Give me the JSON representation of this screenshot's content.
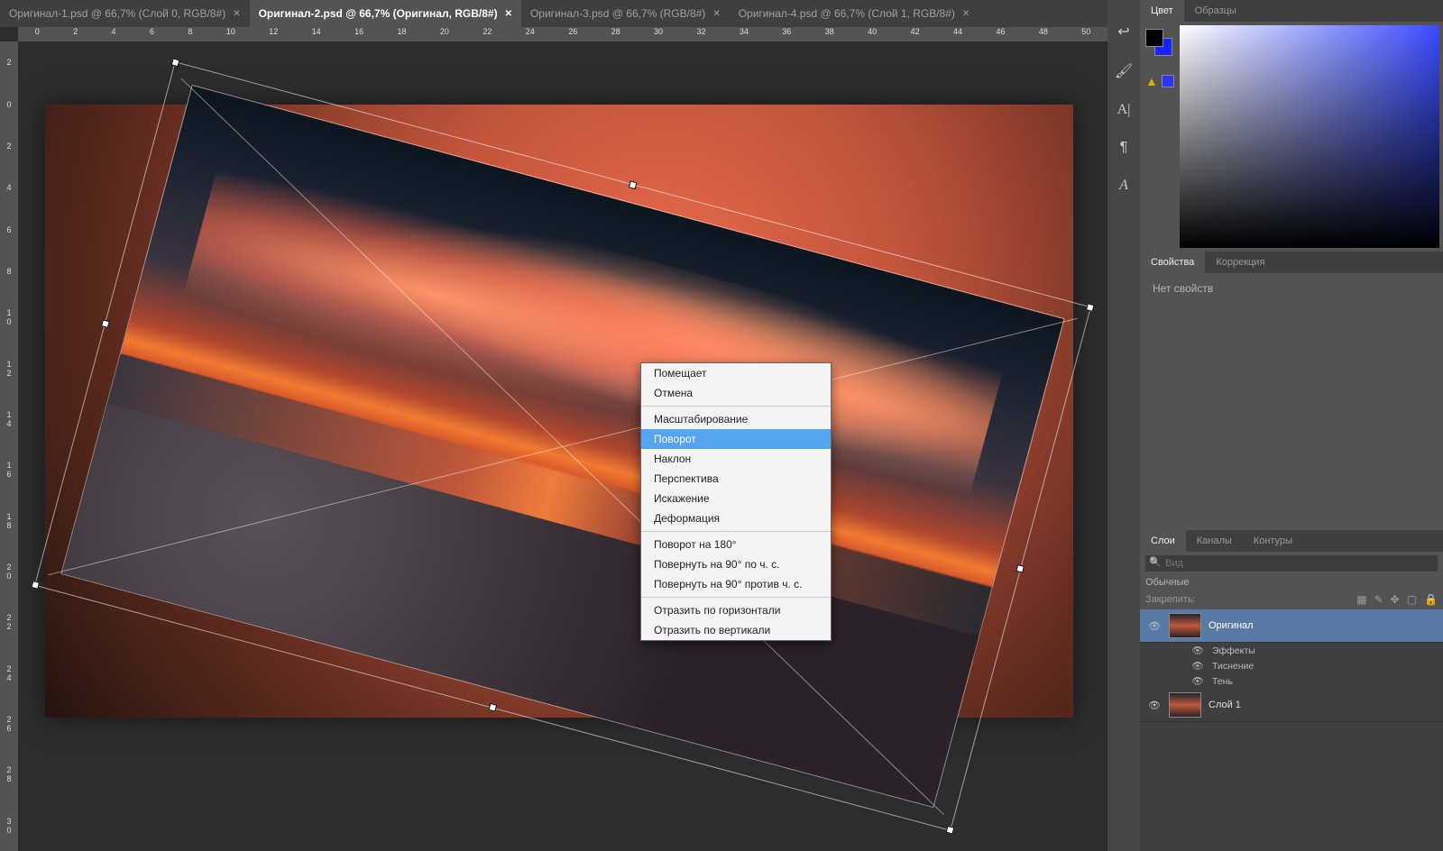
{
  "tabs": [
    {
      "label": "Оригинал-1.psd @ 66,7% (Слой 0, RGB/8#)"
    },
    {
      "label": "Оригинал-2.psd @ 66,7% (Оригинал, RGB/8#)"
    },
    {
      "label": "Оригинал-3.psd @ 66,7% (RGB/8#)"
    },
    {
      "label": "Оригинал-4.psd @ 66,7% (Слой 1, RGB/8#)"
    }
  ],
  "active_tab_index": 1,
  "ruler_h": [
    "0",
    "2",
    "4",
    "6",
    "8",
    "10",
    "12",
    "14",
    "16",
    "18",
    "20",
    "22",
    "24",
    "26",
    "28",
    "30",
    "32",
    "34",
    "36",
    "38",
    "40",
    "42",
    "44",
    "46",
    "48",
    "50"
  ],
  "ruler_v": [
    "2",
    "0",
    "2",
    "4",
    "6",
    "8",
    "1\n0",
    "1\n2",
    "1\n4",
    "1\n6",
    "1\n8",
    "2\n0",
    "2\n2",
    "2\n4",
    "2\n6",
    "2\n8",
    "3\n0"
  ],
  "contextmenu": [
    {
      "type": "item",
      "label": "Помещает"
    },
    {
      "type": "item",
      "label": "Отмена"
    },
    {
      "type": "sep"
    },
    {
      "type": "item",
      "label": "Масштабирование"
    },
    {
      "type": "item",
      "label": "Поворот",
      "highlight": true
    },
    {
      "type": "item",
      "label": "Наклон"
    },
    {
      "type": "item",
      "label": "Перспектива"
    },
    {
      "type": "item",
      "label": "Искажение"
    },
    {
      "type": "item",
      "label": "Деформация"
    },
    {
      "type": "sep"
    },
    {
      "type": "item",
      "label": "Поворот на 180°"
    },
    {
      "type": "item",
      "label": "Повернуть на 90° по ч. с."
    },
    {
      "type": "item",
      "label": "Повернуть на 90° против ч. с."
    },
    {
      "type": "sep"
    },
    {
      "type": "item",
      "label": "Отразить по горизонтали"
    },
    {
      "type": "item",
      "label": "Отразить по вертикали"
    }
  ],
  "dock": {
    "color_tabs": [
      "Цвет",
      "Образцы"
    ],
    "props_tabs": [
      "Свойства",
      "Коррекция"
    ],
    "props_text": "Нет свойств",
    "layers_tabs": [
      "Слои",
      "Каналы",
      "Контуры"
    ],
    "search_placeholder": "Вид",
    "blend_mode": "Обычные",
    "lock_label": "Закрепить:",
    "layers": [
      {
        "name": "Оригинал",
        "active": true,
        "thumb": "sunset"
      },
      {
        "name": "Слой 1",
        "active": false,
        "thumb": "sunset"
      }
    ],
    "fx": {
      "header": "Эффекты",
      "items": [
        "Тиснение",
        "Тень"
      ]
    }
  }
}
